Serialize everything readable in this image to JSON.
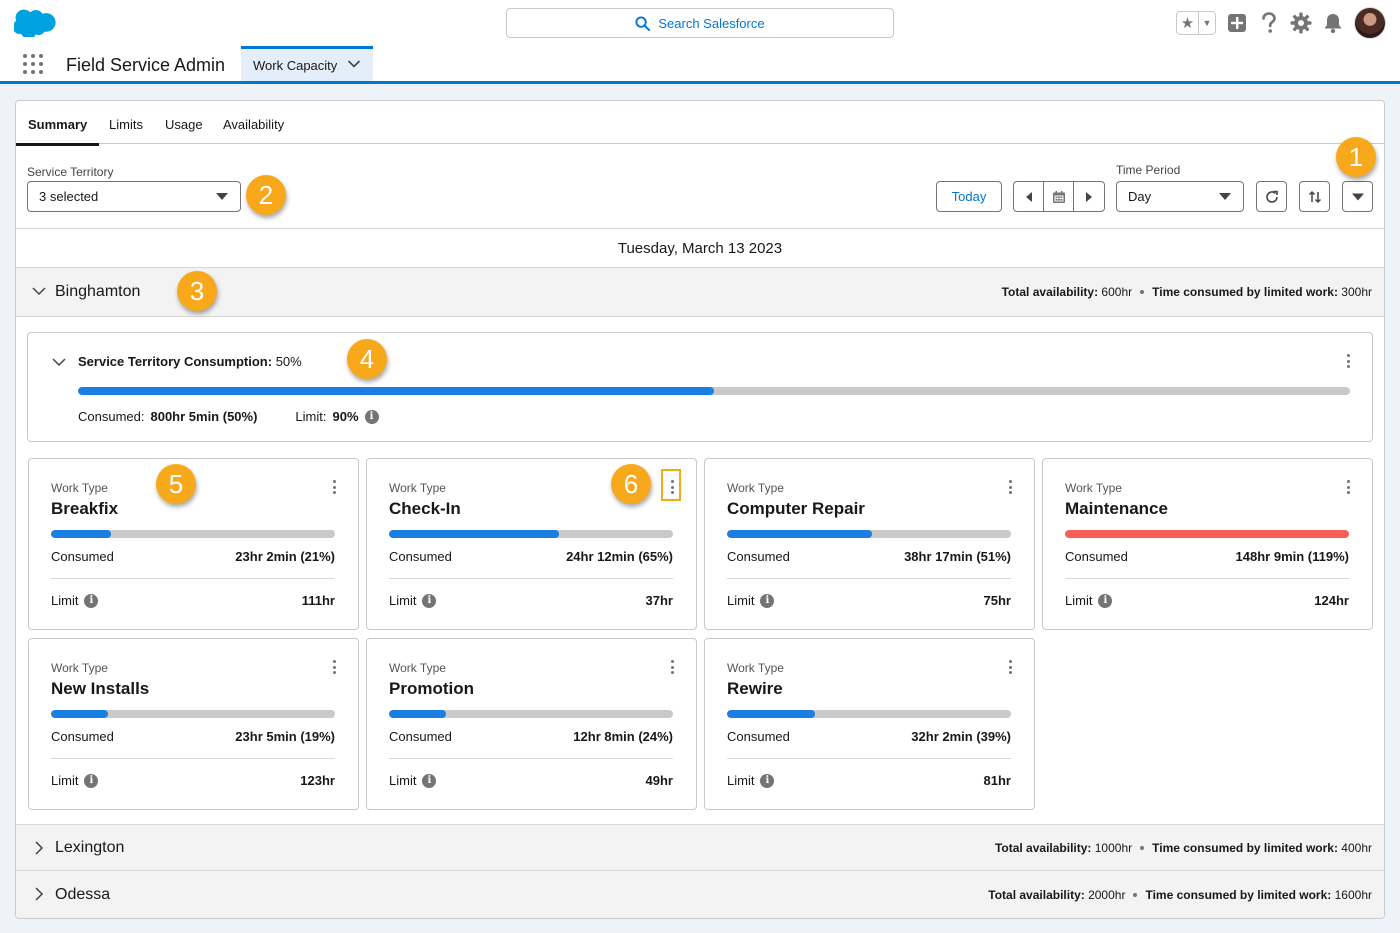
{
  "header": {
    "search_placeholder": "Search Salesforce"
  },
  "nav": {
    "app_name": "Field Service Admin",
    "active_tab": "Work Capacity"
  },
  "tabs": [
    "Summary",
    "Limits",
    "Usage",
    "Availability"
  ],
  "toolbar": {
    "territory_label": "Service Territory",
    "territory_value": "3 selected",
    "today_label": "Today",
    "time_period_label": "Time Period",
    "time_period_value": "Day"
  },
  "date_heading": "Tuesday, March 13 2023",
  "territories": [
    {
      "name": "Binghamton",
      "availability_label": "Total availability:",
      "availability": "600hr",
      "consumed_label": "Time consumed by limited work:",
      "consumed": "300hr",
      "expanded": true
    },
    {
      "name": "Lexington",
      "availability_label": "Total availability:",
      "availability": "1000hr",
      "consumed_label": "Time consumed by limited work:",
      "consumed": "400hr",
      "expanded": false
    },
    {
      "name": "Odessa",
      "availability_label": "Total availability:",
      "availability": "2000hr",
      "consumed_label": "Time consumed by limited work:",
      "consumed": "1600hr",
      "expanded": false
    }
  ],
  "consumption": {
    "title": "Service Territory Consumption:",
    "percent": "50%",
    "progress": 0.5,
    "consumed_label": "Consumed:",
    "consumed_value": "800hr 5min (50%)",
    "limit_label": "Limit:",
    "limit_value": "90%"
  },
  "work_types": [
    {
      "label": "Work Type",
      "name": "Breakfix",
      "consumed_label": "Consumed",
      "consumed": "23hr 2min (21%)",
      "limit_label": "Limit",
      "limit": "111hr",
      "progress": 0.21,
      "over": false
    },
    {
      "label": "Work Type",
      "name": "Check-In",
      "consumed_label": "Consumed",
      "consumed": "24hr 12min (65%)",
      "limit_label": "Limit",
      "limit": "37hr",
      "progress": 0.6,
      "over": false
    },
    {
      "label": "Work Type",
      "name": "Computer Repair",
      "consumed_label": "Consumed",
      "consumed": "38hr 17min (51%)",
      "limit_label": "Limit",
      "limit": "75hr",
      "progress": 0.51,
      "over": false
    },
    {
      "label": "Work Type",
      "name": "Maintenance",
      "consumed_label": "Consumed",
      "consumed": "148hr 9min (119%)",
      "limit_label": "Limit",
      "limit": "124hr",
      "progress": 1.0,
      "over": true
    },
    {
      "label": "Work Type",
      "name": "New Installs",
      "consumed_label": "Consumed",
      "consumed": "23hr 5min (19%)",
      "limit_label": "Limit",
      "limit": "123hr",
      "progress": 0.2,
      "over": false
    },
    {
      "label": "Work Type",
      "name": "Promotion",
      "consumed_label": "Consumed",
      "consumed": "12hr 8min (24%)",
      "limit_label": "Limit",
      "limit": "49hr",
      "progress": 0.2,
      "over": false
    },
    {
      "label": "Work Type",
      "name": "Rewire",
      "consumed_label": "Consumed",
      "consumed": "32hr 2min (39%)",
      "limit_label": "Limit",
      "limit": "81hr",
      "progress": 0.31,
      "over": false
    }
  ],
  "callouts": [
    "1",
    "2",
    "3",
    "4",
    "5",
    "6"
  ],
  "colors": {
    "brand": "#0176d3",
    "progress": "#1b7ee3",
    "over_limit": "#f75f55",
    "callout": "#f7a81b"
  }
}
